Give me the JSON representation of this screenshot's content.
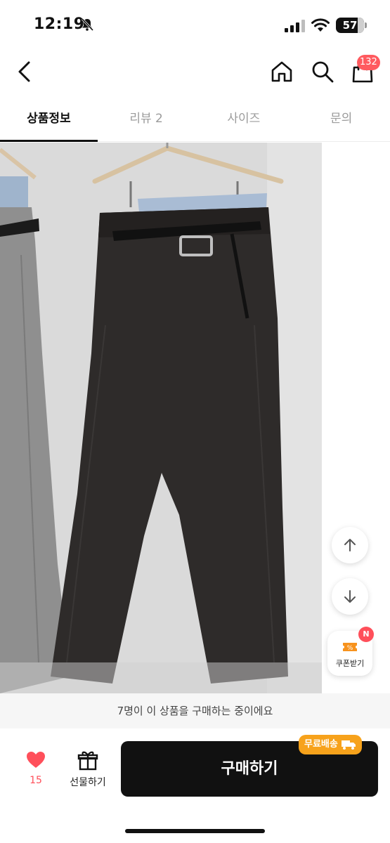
{
  "status_bar": {
    "time": "12:19",
    "battery": "57"
  },
  "header": {
    "cart_count": "132"
  },
  "tabs": [
    {
      "label": "상품정보",
      "active": true
    },
    {
      "label": "리뷰 2",
      "active": false
    },
    {
      "label": "사이즈",
      "active": false
    },
    {
      "label": "문의",
      "active": false
    }
  ],
  "floating": {
    "coupon_label": "쿠폰받기",
    "coupon_badge": "N"
  },
  "notice": "7명이 이 상품을 구매하는 중이에요",
  "action_bar": {
    "like_count": "15",
    "gift_label": "선물하기",
    "buy_label": "구매하기",
    "free_shipping_label": "무료배송"
  },
  "colors": {
    "accent_red": "#ff4f5a",
    "buy_button": "#111111",
    "free_shipping": "#f7a21b"
  }
}
